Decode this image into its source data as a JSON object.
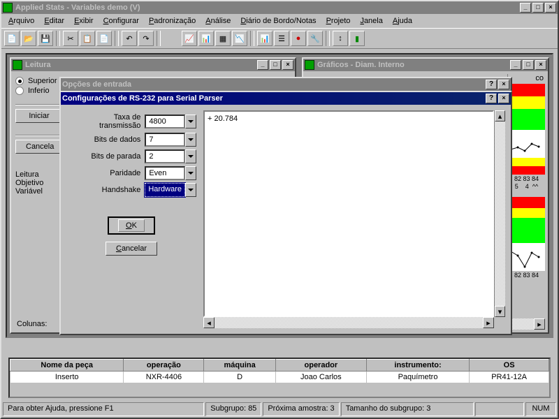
{
  "main_window": {
    "title": "Applied Stats - Variables demo (V)",
    "menu": [
      "Arquivo",
      "Editar",
      "Exibir",
      "Configurar",
      "Padronização",
      "Análise",
      "Diário de Bordo/Notas",
      "Projeto",
      "Janela",
      "Ajuda"
    ]
  },
  "leitura": {
    "title": "Leitura",
    "radio_sup": "Superior",
    "radio_inf": "Inferio",
    "btn_iniciar": "Iniciar",
    "btn_cancelar": "Cancela",
    "lbl1": "Leitura",
    "lbl2": "Objetivo",
    "lbl3": "Variável",
    "colunas": "Colunas:"
  },
  "graficos": {
    "title": "Gráficos - Diam. Interno",
    "axis1": "82 83 84",
    "axis1b": "5    4  ^^",
    "axis2": "82 83 84"
  },
  "opcoes": {
    "title": "Opções de entrada"
  },
  "rs232": {
    "title": "Configurações de RS-232 para Serial Parser",
    "fields": {
      "taxa_label": "Taxa de transmissão",
      "taxa_value": "4800",
      "dados_label": "Bits de dados",
      "dados_value": "7",
      "parada_label": "Bits de parada",
      "parada_value": "2",
      "paridade_label": "Paridade",
      "paridade_value": "Even",
      "handshake_label": "Handshake",
      "handshake_value": "Hardware"
    },
    "ok": "OK",
    "cancelar": "Cancelar",
    "output": "+ 20.784"
  },
  "table": {
    "headers": [
      "Nome da peça",
      "operação",
      "máquina",
      "operador",
      "instrumento:",
      "OS"
    ],
    "row": [
      "Inserto",
      "NXR-4406",
      "D",
      "Joao Carlos",
      "Paquímetro",
      "PR41-12A"
    ]
  },
  "status": {
    "help": "Para obter Ajuda, pressione F1",
    "subgrupo": "Subgrupo: 85",
    "proxima": "Próxima amostra: 3",
    "tamanho": "Tamanho do subgrupo: 3",
    "num": "NUM"
  }
}
